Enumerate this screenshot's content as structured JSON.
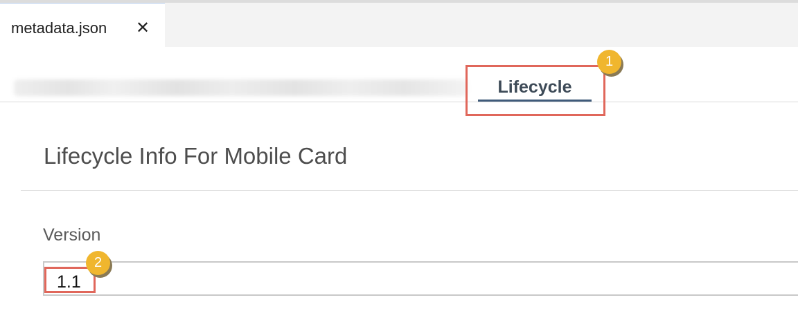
{
  "editor": {
    "tab_label": "metadata.json",
    "close_glyph": "✕"
  },
  "form_tabs": {
    "active_label": "Lifecycle"
  },
  "section": {
    "title": "Lifecycle Info For Mobile Card"
  },
  "fields": {
    "version_label": "Version",
    "version_value": "1.1"
  },
  "annotations": {
    "badge_1": "1",
    "badge_2": "2",
    "highlight_color": "#e0675b",
    "badge_color": "#f0b62e"
  }
}
